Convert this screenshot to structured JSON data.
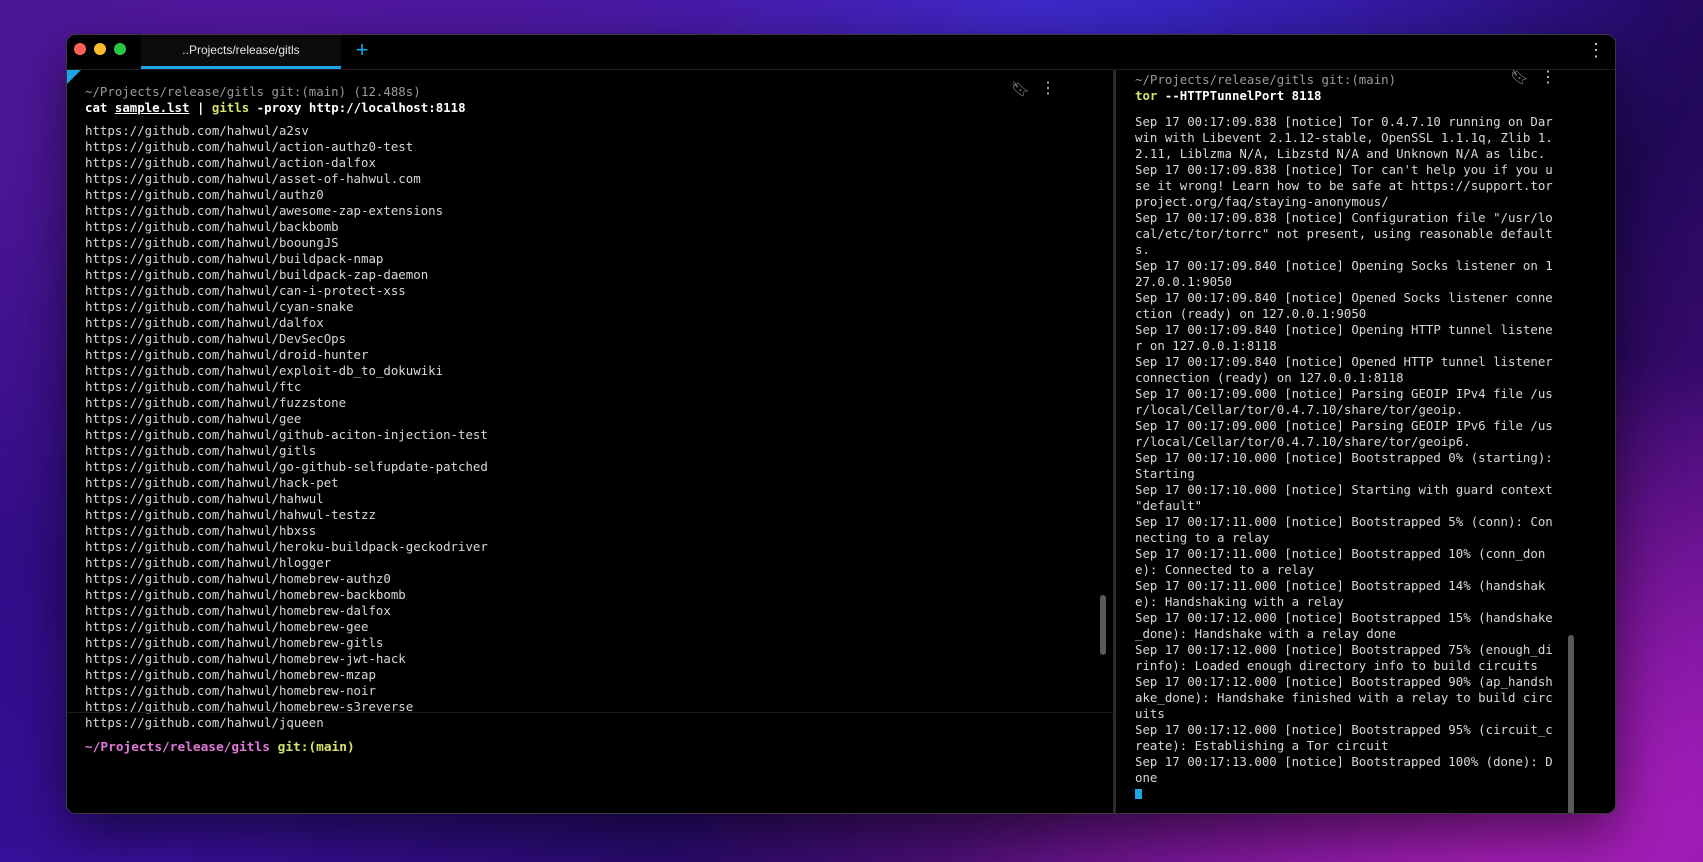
{
  "tab": {
    "title": "..Projects/release/gitls",
    "new_tab": "+"
  },
  "left": {
    "block_header": "~/Projects/release/gitls git:(main) (12.488s)",
    "command": {
      "cat": "cat",
      "file": "sample.lst",
      "pipe": "|",
      "exe": "gitls",
      "args": "-proxy http://localhost:8118"
    },
    "output": [
      "https://github.com/hahwul/a2sv",
      "https://github.com/hahwul/action-authz0-test",
      "https://github.com/hahwul/action-dalfox",
      "https://github.com/hahwul/asset-of-hahwul.com",
      "https://github.com/hahwul/authz0",
      "https://github.com/hahwul/awesome-zap-extensions",
      "https://github.com/hahwul/backbomb",
      "https://github.com/hahwul/booungJS",
      "https://github.com/hahwul/buildpack-nmap",
      "https://github.com/hahwul/buildpack-zap-daemon",
      "https://github.com/hahwul/can-i-protect-xss",
      "https://github.com/hahwul/cyan-snake",
      "https://github.com/hahwul/dalfox",
      "https://github.com/hahwul/DevSecOps",
      "https://github.com/hahwul/droid-hunter",
      "https://github.com/hahwul/exploit-db_to_dokuwiki",
      "https://github.com/hahwul/ftc",
      "https://github.com/hahwul/fuzzstone",
      "https://github.com/hahwul/gee",
      "https://github.com/hahwul/github-aciton-injection-test",
      "https://github.com/hahwul/gitls",
      "https://github.com/hahwul/go-github-selfupdate-patched",
      "https://github.com/hahwul/hack-pet",
      "https://github.com/hahwul/hahwul",
      "https://github.com/hahwul/hahwul-testzz",
      "https://github.com/hahwul/hbxss",
      "https://github.com/hahwul/heroku-buildpack-geckodriver",
      "https://github.com/hahwul/hlogger",
      "https://github.com/hahwul/homebrew-authz0",
      "https://github.com/hahwul/homebrew-backbomb",
      "https://github.com/hahwul/homebrew-dalfox",
      "https://github.com/hahwul/homebrew-gee",
      "https://github.com/hahwul/homebrew-gitls",
      "https://github.com/hahwul/homebrew-jwt-hack",
      "https://github.com/hahwul/homebrew-mzap",
      "https://github.com/hahwul/homebrew-noir",
      "https://github.com/hahwul/homebrew-s3reverse",
      "https://github.com/hahwul/jqueen"
    ],
    "prompt_path": "~/Projects/release/gitls",
    "prompt_git": "git:(main)"
  },
  "right": {
    "block_header": "~/Projects/release/gitls git:(main)",
    "command": {
      "exe": "tor",
      "args": "--HTTPTunnelPort 8118"
    },
    "output": [
      "Sep 17 00:17:09.838 [notice] Tor 0.4.7.10 running on Darwin with Libevent 2.1.12-stable, OpenSSL 1.1.1q, Zlib 1.2.11, Liblzma N/A, Libzstd N/A and Unknown N/A as libc.",
      "Sep 17 00:17:09.838 [notice] Tor can't help you if you use it wrong! Learn how to be safe at https://support.torproject.org/faq/staying-anonymous/",
      "Sep 17 00:17:09.838 [notice] Configuration file \"/usr/local/etc/tor/torrc\" not present, using reasonable defaults.",
      "Sep 17 00:17:09.840 [notice] Opening Socks listener on 127.0.0.1:9050",
      "Sep 17 00:17:09.840 [notice] Opened Socks listener connection (ready) on 127.0.0.1:9050",
      "Sep 17 00:17:09.840 [notice] Opening HTTP tunnel listener on 127.0.0.1:8118",
      "Sep 17 00:17:09.840 [notice] Opened HTTP tunnel listener connection (ready) on 127.0.0.1:8118",
      "Sep 17 00:17:09.000 [notice] Parsing GEOIP IPv4 file /usr/local/Cellar/tor/0.4.7.10/share/tor/geoip.",
      "Sep 17 00:17:09.000 [notice] Parsing GEOIP IPv6 file /usr/local/Cellar/tor/0.4.7.10/share/tor/geoip6.",
      "Sep 17 00:17:10.000 [notice] Bootstrapped 0% (starting): Starting",
      "Sep 17 00:17:10.000 [notice] Starting with guard context \"default\"",
      "Sep 17 00:17:11.000 [notice] Bootstrapped 5% (conn): Connecting to a relay",
      "Sep 17 00:17:11.000 [notice] Bootstrapped 10% (conn_done): Connected to a relay",
      "Sep 17 00:17:11.000 [notice] Bootstrapped 14% (handshake): Handshaking with a relay",
      "Sep 17 00:17:12.000 [notice] Bootstrapped 15% (handshake_done): Handshake with a relay done",
      "Sep 17 00:17:12.000 [notice] Bootstrapped 75% (enough_dirinfo): Loaded enough directory info to build circuits",
      "Sep 17 00:17:12.000 [notice] Bootstrapped 90% (ap_handshake_done): Handshake finished with a relay to build circuits",
      "Sep 17 00:17:12.000 [notice] Bootstrapped 95% (circuit_create): Establishing a Tor circuit",
      "Sep 17 00:17:13.000 [notice] Bootstrapped 100% (done): Done"
    ]
  }
}
